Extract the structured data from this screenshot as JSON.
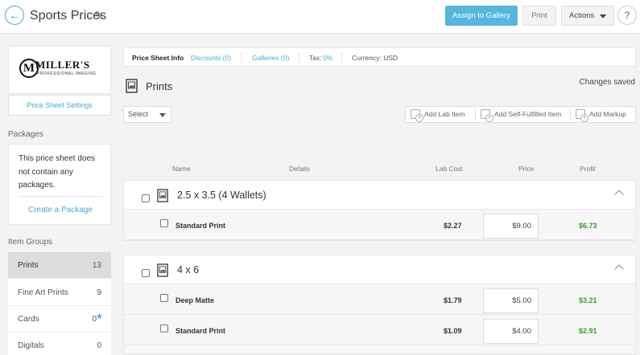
{
  "header": {
    "back_icon": "arrow-left-icon",
    "title": "Sports Prices",
    "edit_icon": "pencil-icon",
    "assign_label": "Assign to Gallery",
    "print_label": "Print",
    "actions_label": "Actions",
    "help_label": "?"
  },
  "sidebar": {
    "logo": {
      "name": "MILLER'S",
      "sub": "PROFESSIONAL IMAGING",
      "mark": "M"
    },
    "settings_label": "Price Sheet Settings",
    "packages_heading": "Packages",
    "packages_empty": "This price sheet does not contain any packages.",
    "create_package_label": "Create a Package",
    "item_groups_heading": "Item Groups",
    "groups": [
      {
        "name": "Prints",
        "count": "13",
        "active": true
      },
      {
        "name": "Fine Art Prints",
        "count": "9"
      },
      {
        "name": "Cards",
        "count": "0",
        "starred": true
      },
      {
        "name": "Digitals",
        "count": "0"
      }
    ]
  },
  "tabs": {
    "info": "Price Sheet Info",
    "discounts": "Discounts (0)",
    "galleries": "Galleries (0)",
    "tax_label": "Tax:",
    "tax_value": "0%",
    "currency": "Currency: USD"
  },
  "main": {
    "section_title": "Prints",
    "status": "Changes saved",
    "select_label": "Select",
    "add_lab_item": "Add Lab Item",
    "add_self_fulfilled": "Add Self-Fulfilled Item",
    "add_markup": "Add Markup",
    "columns": {
      "name": "Name",
      "details": "Details",
      "lab_cost": "Lab Cost",
      "price": "Price",
      "profit": "Profit"
    },
    "groups": [
      {
        "title": "2.5 x 3.5 (4 Wallets)",
        "rows": [
          {
            "name": "Standard Print",
            "lab_cost": "$2.27",
            "price": "$9.00",
            "profit": "$6.73"
          }
        ]
      },
      {
        "title": "4 x 6",
        "rows": [
          {
            "name": "Deep Matte",
            "lab_cost": "$1.79",
            "price": "$5.00",
            "profit": "$3.21"
          },
          {
            "name": "Standard Print",
            "lab_cost": "$1.09",
            "price": "$4.00",
            "profit": "$2.91"
          }
        ]
      }
    ]
  },
  "colors": {
    "accent": "#49a9d6",
    "profit": "#3a9b2c",
    "assign_button": "#56b6dd"
  }
}
